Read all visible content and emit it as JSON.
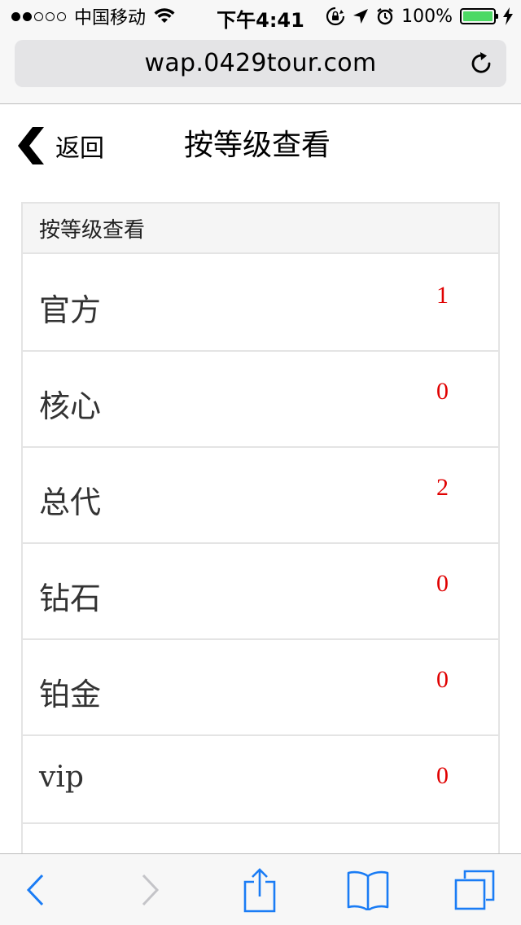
{
  "status_bar": {
    "carrier": "中国移动",
    "time": "下午4:41",
    "battery": "100%",
    "signal_bars_filled": 2,
    "signal_bars_total": 5
  },
  "browser": {
    "url": "wap.0429tour.com"
  },
  "header": {
    "back_label": "返回",
    "title": "按等级查看"
  },
  "panel": {
    "heading": "按等级查看",
    "levels": [
      {
        "name": "官方",
        "count": "1"
      },
      {
        "name": "核心",
        "count": "0"
      },
      {
        "name": "总代",
        "count": "2"
      },
      {
        "name": "钻石",
        "count": "0"
      },
      {
        "name": "铂金",
        "count": "0"
      },
      {
        "name": "vip",
        "count": "0"
      }
    ]
  },
  "colors": {
    "count_red": "#e00000",
    "toolbar_blue": "#1a7cf5",
    "battery_green": "#4cd964"
  },
  "icons": {
    "back": "chevron-left-icon",
    "reload": "reload-icon",
    "toolbar": [
      "back-arrow-icon",
      "forward-arrow-icon",
      "share-icon",
      "bookmarks-icon",
      "tabs-icon"
    ]
  }
}
